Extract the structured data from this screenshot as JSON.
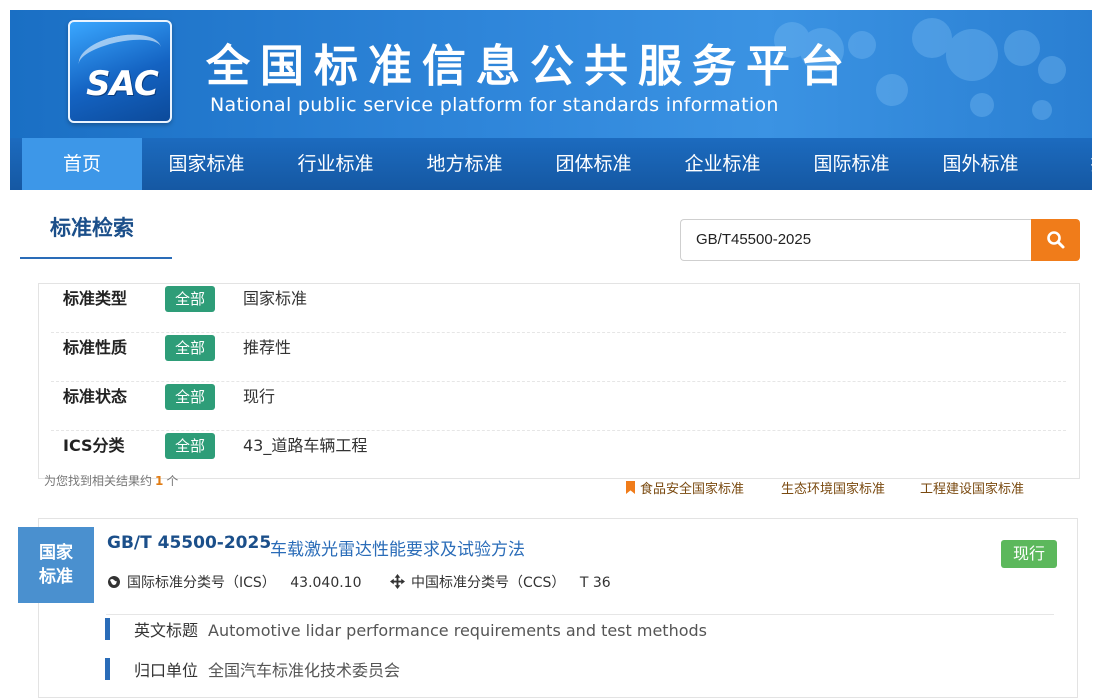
{
  "header": {
    "logo_text": "SAC",
    "title_cn": "全国标准信息公共服务平台",
    "title_en": "National public service platform  for standards information"
  },
  "nav": {
    "items": [
      "首页",
      "国家标准",
      "行业标准",
      "地方标准",
      "团体标准",
      "企业标准",
      "国际标准",
      "国外标准",
      "技术"
    ]
  },
  "search": {
    "tab_label": "标准检索",
    "query": "GB/T45500-2025",
    "button_icon": "search-icon"
  },
  "filters": [
    {
      "label": "标准类型",
      "tag": "全部",
      "value": "国家标准"
    },
    {
      "label": "标准性质",
      "tag": "全部",
      "value": "推荐性"
    },
    {
      "label": "标准状态",
      "tag": "全部",
      "value": "现行"
    },
    {
      "label": "ICS分类",
      "tag": "全部",
      "value": "43_道路车辆工程"
    }
  ],
  "results_summary": {
    "prefix": "为您找到相关结果约",
    "count": "1",
    "suffix": "个"
  },
  "category_links": [
    "食品安全国家标准",
    "生态环境国家标准",
    "工程建设国家标准"
  ],
  "result": {
    "type_badge_line1": "国家",
    "type_badge_line2": "标准",
    "std_no": "GB/T 45500-2025",
    "title": "车载激光雷达性能要求及试验方法",
    "status": "现行",
    "ics_label": "国际标准分类号（ICS）",
    "ics_value": "43.040.10",
    "ccs_label": "中国标准分类号（CCS）",
    "ccs_value": "T 36",
    "en_title_label": "英文标题",
    "en_title_value": "Automotive lidar performance requirements and test methods",
    "org_label": "归口单位",
    "org_value": "全国汽车标准化技术委员会"
  },
  "colors": {
    "banner_blue": "#2f86da",
    "nav_blue": "#1c6bbf",
    "nav_active": "#3d97e8",
    "tag_green": "#2e9d78",
    "search_orange": "#f07c1a",
    "status_green": "#5cb85c",
    "badge_blue": "#4a90cf"
  }
}
